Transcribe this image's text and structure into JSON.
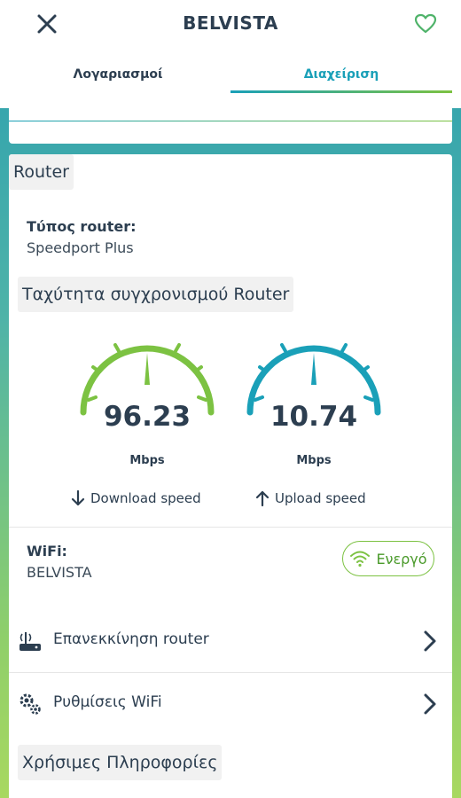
{
  "header": {
    "title": "BELVISTA",
    "close_icon": "close-icon",
    "favorite_icon": "heart-icon"
  },
  "tabs": [
    {
      "label": "Λογαριασμοί",
      "active": false
    },
    {
      "label": "Διαχείριση",
      "active": true
    }
  ],
  "router": {
    "section_title": "Router",
    "type_label": "Τύπος router:",
    "type_value": "Speedport Plus",
    "sync_title": "Ταχύτητα συγχρονισμού Router",
    "download": {
      "value": "96.23",
      "unit": "Mbps",
      "label": "Download speed",
      "color": "#7cc242"
    },
    "upload": {
      "value": "10.74",
      "unit": "Mbps",
      "label": "Upload speed",
      "color": "#1aa0b8"
    }
  },
  "wifi": {
    "label": "WiFi:",
    "value": "BELVISTA",
    "status": "Ενεργό"
  },
  "actions": [
    {
      "label": "Επανεκκίνηση router",
      "icon": "router-restart-icon"
    },
    {
      "label": "Ρυθμίσεις WiFi",
      "icon": "gear-icon"
    }
  ],
  "info": {
    "section_title": "Χρήσιμες Πληροφορίες"
  }
}
